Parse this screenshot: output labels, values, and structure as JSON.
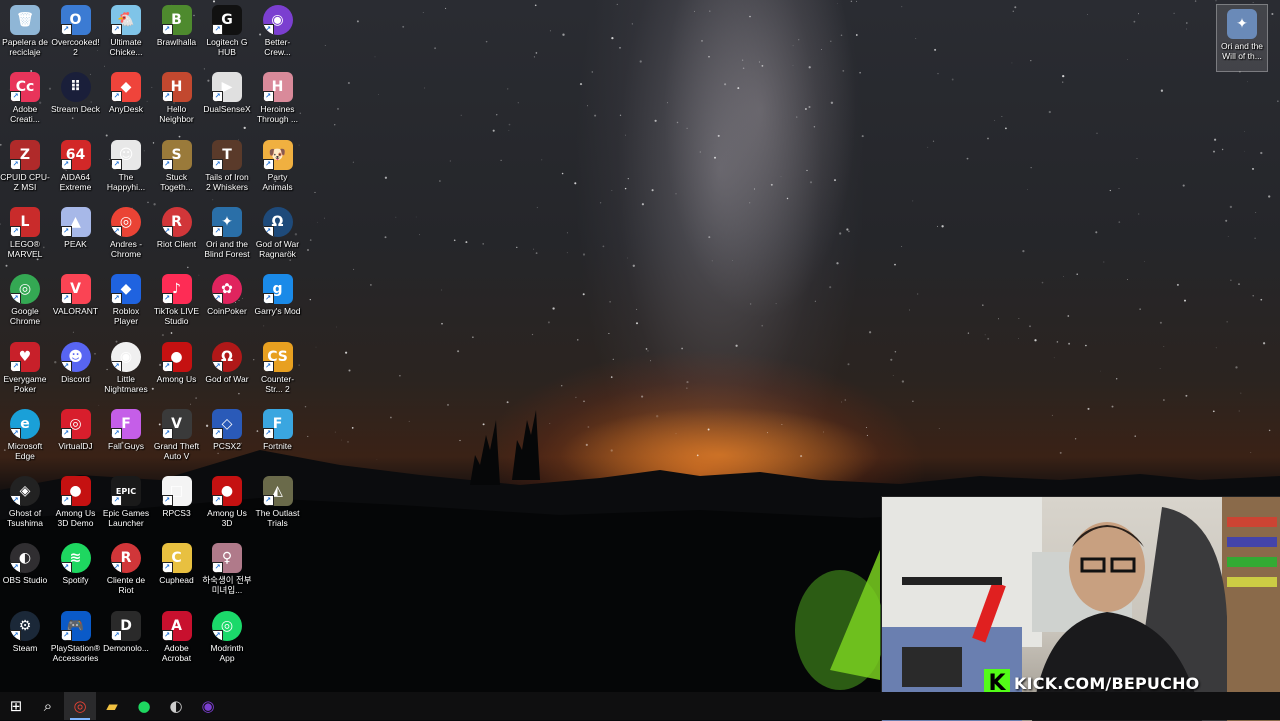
{
  "desktop": {
    "icons": [
      {
        "id": "recycle",
        "label": "Papelera de reciclaje",
        "glyph": "🗑",
        "color": "#8fb6d6",
        "round": false,
        "shortcut": false
      },
      {
        "id": "overcooked",
        "label": "Overcooked! 2",
        "glyph": "O",
        "color": "#3b7bd3",
        "round": false,
        "shortcut": true
      },
      {
        "id": "ultimate-chicken",
        "label": "Ultimate Chicke...",
        "glyph": "🐔",
        "color": "#7fc4e8",
        "round": false,
        "shortcut": true
      },
      {
        "id": "brawlhalla",
        "label": "Brawlhalla",
        "glyph": "B",
        "color": "#4e8a2e",
        "round": false,
        "shortcut": true
      },
      {
        "id": "logitech",
        "label": "Logitech G HUB",
        "glyph": "G",
        "color": "#111111",
        "round": false,
        "shortcut": true
      },
      {
        "id": "better-crewlink",
        "label": "Better-Crew...",
        "glyph": "◉",
        "color": "#7b3fd0",
        "round": true,
        "shortcut": true
      },
      {
        "id": "adobe-cc",
        "label": "Adobe Creati...",
        "glyph": "Cc",
        "color": "#e8345a",
        "round": false,
        "shortcut": true
      },
      {
        "id": "stream-deck",
        "label": "Stream Deck",
        "glyph": "⠿",
        "color": "#1a1f3a",
        "round": true,
        "shortcut": false
      },
      {
        "id": "anydesk",
        "label": "AnyDesk",
        "glyph": "◆",
        "color": "#ef443b",
        "round": false,
        "shortcut": true
      },
      {
        "id": "hello-neighbor",
        "label": "Hello Neighbor",
        "glyph": "H",
        "color": "#c2482f",
        "round": false,
        "shortcut": true
      },
      {
        "id": "dualsensex",
        "label": "DualSenseX",
        "glyph": "▶",
        "color": "#e0e0e0",
        "round": false,
        "shortcut": true
      },
      {
        "id": "heroines",
        "label": "Heroines Through ...",
        "glyph": "H",
        "color": "#d98a9a",
        "round": false,
        "shortcut": true
      },
      {
        "id": "cpuz",
        "label": "CPUID CPU-Z MSI",
        "glyph": "Z",
        "color": "#b02a2a",
        "round": false,
        "shortcut": true
      },
      {
        "id": "aida64",
        "label": "AIDA64 Extreme",
        "glyph": "64",
        "color": "#d22828",
        "round": false,
        "shortcut": true
      },
      {
        "id": "happyhills",
        "label": "The Happyhi...",
        "glyph": "☺",
        "color": "#e8e8e8",
        "round": false,
        "shortcut": true
      },
      {
        "id": "stuck-together",
        "label": "Stuck Togeth...",
        "glyph": "S",
        "color": "#9a7a3a",
        "round": false,
        "shortcut": true
      },
      {
        "id": "tails-of-iron",
        "label": "Tails of Iron 2 Whiskers o...",
        "glyph": "T",
        "color": "#5a3a2a",
        "round": false,
        "shortcut": true
      },
      {
        "id": "party-animals",
        "label": "Party Animals",
        "glyph": "🐶",
        "color": "#f0b040",
        "round": false,
        "shortcut": true
      },
      {
        "id": "lego-marvel",
        "label": "LEGO® MARVEL Su...",
        "glyph": "L",
        "color": "#c92b2b",
        "round": false,
        "shortcut": true
      },
      {
        "id": "peak",
        "label": "PEAK",
        "glyph": "▲",
        "color": "#a7b8e8",
        "round": false,
        "shortcut": true
      },
      {
        "id": "andres-chrome",
        "label": "Andres - Chrome",
        "glyph": "◎",
        "color": "#ea4335",
        "round": true,
        "shortcut": true
      },
      {
        "id": "riot-client",
        "label": "Riot Client",
        "glyph": "R",
        "color": "#d13639",
        "round": true,
        "shortcut": true
      },
      {
        "id": "ori-blind",
        "label": "Ori and the Blind Forest",
        "glyph": "✦",
        "color": "#2a6fa8",
        "round": false,
        "shortcut": true
      },
      {
        "id": "gow-ragnarok",
        "label": "God of War Ragnarök",
        "glyph": "Ω",
        "color": "#1e4a7a",
        "round": true,
        "shortcut": true
      },
      {
        "id": "google-chrome",
        "label": "Google Chrome",
        "glyph": "◎",
        "color": "#34a853",
        "round": true,
        "shortcut": true
      },
      {
        "id": "valorant",
        "label": "VALORANT",
        "glyph": "V",
        "color": "#fa4454",
        "round": false,
        "shortcut": true
      },
      {
        "id": "roblox",
        "label": "Roblox Player",
        "glyph": "◆",
        "color": "#1f63e0",
        "round": false,
        "shortcut": true
      },
      {
        "id": "tiktok-live",
        "label": "TikTok LIVE Studio",
        "glyph": "♪",
        "color": "#fe2c55",
        "round": false,
        "shortcut": true
      },
      {
        "id": "coinpoker",
        "label": "CoinPoker",
        "glyph": "✿",
        "color": "#e0245e",
        "round": true,
        "shortcut": true
      },
      {
        "id": "garrys-mod",
        "label": "Garry's Mod",
        "glyph": "g",
        "color": "#1a8ae8",
        "round": false,
        "shortcut": true
      },
      {
        "id": "everygame",
        "label": "Everygame Poker",
        "glyph": "♥",
        "color": "#c8202a",
        "round": false,
        "shortcut": true
      },
      {
        "id": "discord",
        "label": "Discord",
        "glyph": "☻",
        "color": "#5865f2",
        "round": true,
        "shortcut": true
      },
      {
        "id": "little-nightmares",
        "label": "Little Nightmares",
        "glyph": "◉",
        "color": "#f0f0f0",
        "round": true,
        "shortcut": true
      },
      {
        "id": "among-us",
        "label": "Among Us",
        "glyph": "●",
        "color": "#c51111",
        "round": false,
        "shortcut": true
      },
      {
        "id": "god-of-war",
        "label": "God of War",
        "glyph": "Ω",
        "color": "#b01818",
        "round": true,
        "shortcut": true
      },
      {
        "id": "cs2",
        "label": "Counter-Str... 2",
        "glyph": "CS",
        "color": "#e8a020",
        "round": false,
        "shortcut": true
      },
      {
        "id": "edge",
        "label": "Microsoft Edge",
        "glyph": "e",
        "color": "#1aa0d8",
        "round": true,
        "shortcut": true
      },
      {
        "id": "virtualdj",
        "label": "VirtualDJ",
        "glyph": "◎",
        "color": "#d81e2c",
        "round": false,
        "shortcut": true
      },
      {
        "id": "fall-guys",
        "label": "Fall Guys",
        "glyph": "F",
        "color": "#c55ee8",
        "round": false,
        "shortcut": true
      },
      {
        "id": "gta-v",
        "label": "Grand Theft Auto V",
        "glyph": "V",
        "color": "#3a3a3a",
        "round": false,
        "shortcut": true
      },
      {
        "id": "pcsx2",
        "label": "PCSX2",
        "glyph": "◇",
        "color": "#2a5ab8",
        "round": false,
        "shortcut": true
      },
      {
        "id": "fortnite",
        "label": "Fortnite",
        "glyph": "F",
        "color": "#3aa6e0",
        "round": false,
        "shortcut": true
      },
      {
        "id": "ghost-tsushima",
        "label": "Ghost of Tsushima V...",
        "glyph": "◈",
        "color": "#222222",
        "round": true,
        "shortcut": true
      },
      {
        "id": "among-us-demo",
        "label": "Among Us 3D Demo",
        "glyph": "●",
        "color": "#c51111",
        "round": false,
        "shortcut": true
      },
      {
        "id": "epic-games",
        "label": "Epic Games Launcher",
        "glyph": "EPIC",
        "color": "#1a1a1a",
        "round": false,
        "shortcut": true
      },
      {
        "id": "rpcs3",
        "label": "RPCS3",
        "glyph": "□",
        "color": "#f4f4f4",
        "round": false,
        "shortcut": true
      },
      {
        "id": "among-us-3d",
        "label": "Among Us 3D",
        "glyph": "●",
        "color": "#c51111",
        "round": false,
        "shortcut": true
      },
      {
        "id": "outlast-trials",
        "label": "The Outlast Trials",
        "glyph": "◭",
        "color": "#6a6a4a",
        "round": false,
        "shortcut": true
      },
      {
        "id": "obs",
        "label": "OBS Studio",
        "glyph": "◐",
        "color": "#302e31",
        "round": true,
        "shortcut": true
      },
      {
        "id": "spotify",
        "label": "Spotify",
        "glyph": "≋",
        "color": "#1ed760",
        "round": true,
        "shortcut": true
      },
      {
        "id": "cliente-riot",
        "label": "Cliente de Riot",
        "glyph": "R",
        "color": "#d13639",
        "round": true,
        "shortcut": true
      },
      {
        "id": "cuphead",
        "label": "Cuphead",
        "glyph": "C",
        "color": "#e8c040",
        "round": false,
        "shortcut": true
      },
      {
        "id": "korean-video",
        "label": "하숙생이 전부 미녀입...",
        "glyph": "♀",
        "color": "#b07a8a",
        "round": false,
        "shortcut": true
      },
      {
        "id": "steam",
        "label": "Steam",
        "glyph": "⚙",
        "color": "#1b2838",
        "round": true,
        "shortcut": true
      },
      {
        "id": "ps-accessories",
        "label": "PlayStation® Accessories",
        "glyph": "🎮",
        "color": "#0a5ac8",
        "round": false,
        "shortcut": true
      },
      {
        "id": "demonologist",
        "label": "Demonolo...",
        "glyph": "D",
        "color": "#2a2a2a",
        "round": false,
        "shortcut": true
      },
      {
        "id": "adobe-acrobat",
        "label": "Adobe Acrobat",
        "glyph": "A",
        "color": "#c8102e",
        "round": false,
        "shortcut": true
      },
      {
        "id": "modrinth",
        "label": "Modrinth App",
        "glyph": "◎",
        "color": "#1bd96a",
        "round": true,
        "shortcut": true
      }
    ],
    "corner_icon": {
      "id": "ori-will",
      "label": "Ori and the Will of th...",
      "glyph": "✦",
      "color": "#6a8ab8"
    }
  },
  "taskbar": {
    "buttons": [
      {
        "id": "start",
        "icon": "windows-icon",
        "glyph": "⊞",
        "color": "#ffffff",
        "active": false
      },
      {
        "id": "search",
        "icon": "search-icon",
        "glyph": "⌕",
        "color": "#ffffff",
        "active": false
      },
      {
        "id": "chrome",
        "icon": "chrome-icon",
        "glyph": "◎",
        "color": "#ea4335",
        "active": true
      },
      {
        "id": "explorer",
        "icon": "folder-icon",
        "glyph": "▰",
        "color": "#f0c040",
        "active": false
      },
      {
        "id": "spotify",
        "icon": "spotify-icon",
        "glyph": "●",
        "color": "#1ed760",
        "active": false
      },
      {
        "id": "obs",
        "icon": "obs-icon",
        "glyph": "◐",
        "color": "#cccccc",
        "active": false
      },
      {
        "id": "better-crewlink",
        "icon": "crewlink-icon",
        "glyph": "◉",
        "color": "#7b3fd0",
        "active": false
      }
    ]
  },
  "webcam": {
    "overlay_text": "KICK.COM/BEPUCHO",
    "logo_letter": "K",
    "accent": "#53fc18"
  }
}
